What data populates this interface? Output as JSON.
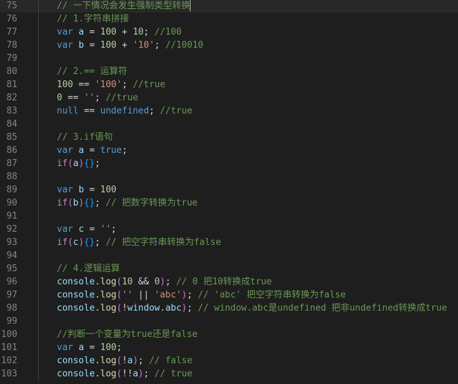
{
  "editor": {
    "lines": [
      {
        "n": "75",
        "tokens": [
          {
            "t": "// 一下情况会发生强制类型转换",
            "c": "comment"
          }
        ],
        "current": true
      },
      {
        "n": "76",
        "tokens": [
          {
            "t": "// 1.字符串拼接",
            "c": "comment"
          }
        ]
      },
      {
        "n": "77",
        "tokens": [
          {
            "t": "var",
            "c": "kw"
          },
          {
            "t": " ",
            "c": ""
          },
          {
            "t": "a",
            "c": "id"
          },
          {
            "t": " = ",
            "c": ""
          },
          {
            "t": "100",
            "c": "num"
          },
          {
            "t": " + ",
            "c": ""
          },
          {
            "t": "10",
            "c": "num"
          },
          {
            "t": "; ",
            "c": ""
          },
          {
            "t": "//100",
            "c": "comment"
          }
        ]
      },
      {
        "n": "78",
        "tokens": [
          {
            "t": "var",
            "c": "kw"
          },
          {
            "t": " ",
            "c": ""
          },
          {
            "t": "b",
            "c": "id"
          },
          {
            "t": " = ",
            "c": ""
          },
          {
            "t": "100",
            "c": "num"
          },
          {
            "t": " + ",
            "c": ""
          },
          {
            "t": "'10'",
            "c": "str"
          },
          {
            "t": "; ",
            "c": ""
          },
          {
            "t": "//10010",
            "c": "comment"
          }
        ]
      },
      {
        "n": "79",
        "tokens": []
      },
      {
        "n": "80",
        "tokens": [
          {
            "t": "// 2.== 运算符",
            "c": "comment"
          }
        ]
      },
      {
        "n": "81",
        "tokens": [
          {
            "t": "100",
            "c": "num"
          },
          {
            "t": " == ",
            "c": ""
          },
          {
            "t": "'100'",
            "c": "str"
          },
          {
            "t": "; ",
            "c": ""
          },
          {
            "t": "//true",
            "c": "comment"
          }
        ]
      },
      {
        "n": "82",
        "tokens": [
          {
            "t": "0",
            "c": "num"
          },
          {
            "t": " == ",
            "c": ""
          },
          {
            "t": "''",
            "c": "str"
          },
          {
            "t": "; ",
            "c": ""
          },
          {
            "t": "//true",
            "c": "comment"
          }
        ]
      },
      {
        "n": "83",
        "tokens": [
          {
            "t": "null",
            "c": "kw"
          },
          {
            "t": " == ",
            "c": ""
          },
          {
            "t": "undefined",
            "c": "kw"
          },
          {
            "t": "; ",
            "c": ""
          },
          {
            "t": "//true",
            "c": "comment"
          }
        ]
      },
      {
        "n": "84",
        "tokens": []
      },
      {
        "n": "85",
        "tokens": [
          {
            "t": "// 3.if语句",
            "c": "comment"
          }
        ]
      },
      {
        "n": "86",
        "tokens": [
          {
            "t": "var",
            "c": "kw"
          },
          {
            "t": " ",
            "c": ""
          },
          {
            "t": "a",
            "c": "id"
          },
          {
            "t": " = ",
            "c": ""
          },
          {
            "t": "true",
            "c": "kw"
          },
          {
            "t": ";",
            "c": ""
          }
        ]
      },
      {
        "n": "87",
        "tokens": [
          {
            "t": "if",
            "c": "ctl"
          },
          {
            "t": "(",
            "c": "paren"
          },
          {
            "t": "a",
            "c": "id"
          },
          {
            "t": ")",
            "c": "paren"
          },
          {
            "t": "{}",
            "c": "brace"
          },
          {
            "t": ";",
            "c": ""
          }
        ]
      },
      {
        "n": "88",
        "tokens": []
      },
      {
        "n": "89",
        "tokens": [
          {
            "t": "var",
            "c": "kw"
          },
          {
            "t": " ",
            "c": ""
          },
          {
            "t": "b",
            "c": "id"
          },
          {
            "t": " = ",
            "c": ""
          },
          {
            "t": "100",
            "c": "num"
          }
        ]
      },
      {
        "n": "90",
        "tokens": [
          {
            "t": "if",
            "c": "ctl"
          },
          {
            "t": "(",
            "c": "paren"
          },
          {
            "t": "b",
            "c": "id"
          },
          {
            "t": ")",
            "c": "paren"
          },
          {
            "t": "{}",
            "c": "brace"
          },
          {
            "t": "; ",
            "c": ""
          },
          {
            "t": "// 把数字转换为true",
            "c": "comment"
          }
        ]
      },
      {
        "n": "91",
        "tokens": []
      },
      {
        "n": "92",
        "tokens": [
          {
            "t": "var",
            "c": "kw"
          },
          {
            "t": " ",
            "c": ""
          },
          {
            "t": "c",
            "c": "id"
          },
          {
            "t": " = ",
            "c": ""
          },
          {
            "t": "''",
            "c": "str"
          },
          {
            "t": ";",
            "c": ""
          }
        ]
      },
      {
        "n": "93",
        "tokens": [
          {
            "t": "if",
            "c": "ctl"
          },
          {
            "t": "(",
            "c": "paren"
          },
          {
            "t": "c",
            "c": "id"
          },
          {
            "t": ")",
            "c": "paren"
          },
          {
            "t": "{}",
            "c": "brace"
          },
          {
            "t": "; ",
            "c": ""
          },
          {
            "t": "// 把空字符串转换为false",
            "c": "comment"
          }
        ]
      },
      {
        "n": "94",
        "tokens": []
      },
      {
        "n": "95",
        "tokens": [
          {
            "t": "// 4.逻辑运算",
            "c": "comment"
          }
        ]
      },
      {
        "n": "96",
        "tokens": [
          {
            "t": "console",
            "c": "id"
          },
          {
            "t": ".",
            "c": ""
          },
          {
            "t": "log",
            "c": "fn"
          },
          {
            "t": "(",
            "c": "paren"
          },
          {
            "t": "10",
            "c": "num"
          },
          {
            "t": " && ",
            "c": ""
          },
          {
            "t": "0",
            "c": "num"
          },
          {
            "t": ")",
            "c": "paren"
          },
          {
            "t": "; ",
            "c": ""
          },
          {
            "t": "// 0 把10转换成true",
            "c": "comment"
          }
        ]
      },
      {
        "n": "97",
        "tokens": [
          {
            "t": "console",
            "c": "id"
          },
          {
            "t": ".",
            "c": ""
          },
          {
            "t": "log",
            "c": "fn"
          },
          {
            "t": "(",
            "c": "paren"
          },
          {
            "t": "''",
            "c": "str"
          },
          {
            "t": " || ",
            "c": ""
          },
          {
            "t": "'abc'",
            "c": "str"
          },
          {
            "t": ")",
            "c": "paren"
          },
          {
            "t": "; ",
            "c": ""
          },
          {
            "t": "// 'abc' 把空字符串转换为false",
            "c": "comment"
          }
        ]
      },
      {
        "n": "98",
        "tokens": [
          {
            "t": "console",
            "c": "id"
          },
          {
            "t": ".",
            "c": ""
          },
          {
            "t": "log",
            "c": "fn"
          },
          {
            "t": "(",
            "c": "paren"
          },
          {
            "t": "!",
            "c": ""
          },
          {
            "t": "window",
            "c": "id"
          },
          {
            "t": ".",
            "c": ""
          },
          {
            "t": "abc",
            "c": "id"
          },
          {
            "t": ")",
            "c": "paren"
          },
          {
            "t": "; ",
            "c": ""
          },
          {
            "t": "// window.abc是undefined 把非undefined转换成true",
            "c": "comment"
          }
        ]
      },
      {
        "n": "99",
        "tokens": []
      },
      {
        "n": "100",
        "tokens": [
          {
            "t": "//判断一个变量为true还是false",
            "c": "comment"
          }
        ]
      },
      {
        "n": "101",
        "tokens": [
          {
            "t": "var",
            "c": "kw"
          },
          {
            "t": " ",
            "c": ""
          },
          {
            "t": "a",
            "c": "id"
          },
          {
            "t": " = ",
            "c": ""
          },
          {
            "t": "100",
            "c": "num"
          },
          {
            "t": ";",
            "c": ""
          }
        ]
      },
      {
        "n": "102",
        "tokens": [
          {
            "t": "console",
            "c": "id"
          },
          {
            "t": ".",
            "c": ""
          },
          {
            "t": "log",
            "c": "fn"
          },
          {
            "t": "(",
            "c": "paren"
          },
          {
            "t": "!",
            "c": ""
          },
          {
            "t": "a",
            "c": "id"
          },
          {
            "t": ")",
            "c": "paren"
          },
          {
            "t": "; ",
            "c": ""
          },
          {
            "t": "// false",
            "c": "comment"
          }
        ]
      },
      {
        "n": "103",
        "tokens": [
          {
            "t": "console",
            "c": "id"
          },
          {
            "t": ".",
            "c": ""
          },
          {
            "t": "log",
            "c": "fn"
          },
          {
            "t": "(",
            "c": "paren"
          },
          {
            "t": "!!",
            "c": ""
          },
          {
            "t": "a",
            "c": "id"
          },
          {
            "t": ")",
            "c": "paren"
          },
          {
            "t": "; ",
            "c": ""
          },
          {
            "t": "// true",
            "c": "comment"
          }
        ]
      }
    ]
  },
  "theme": {
    "background": "#1e1e1e",
    "line_number": "#858585",
    "comment": "#6a9955",
    "keyword": "#569cd6",
    "number": "#b5cea8",
    "string": "#ce9178",
    "identifier": "#9cdcfe",
    "function": "#dcdcaa"
  }
}
